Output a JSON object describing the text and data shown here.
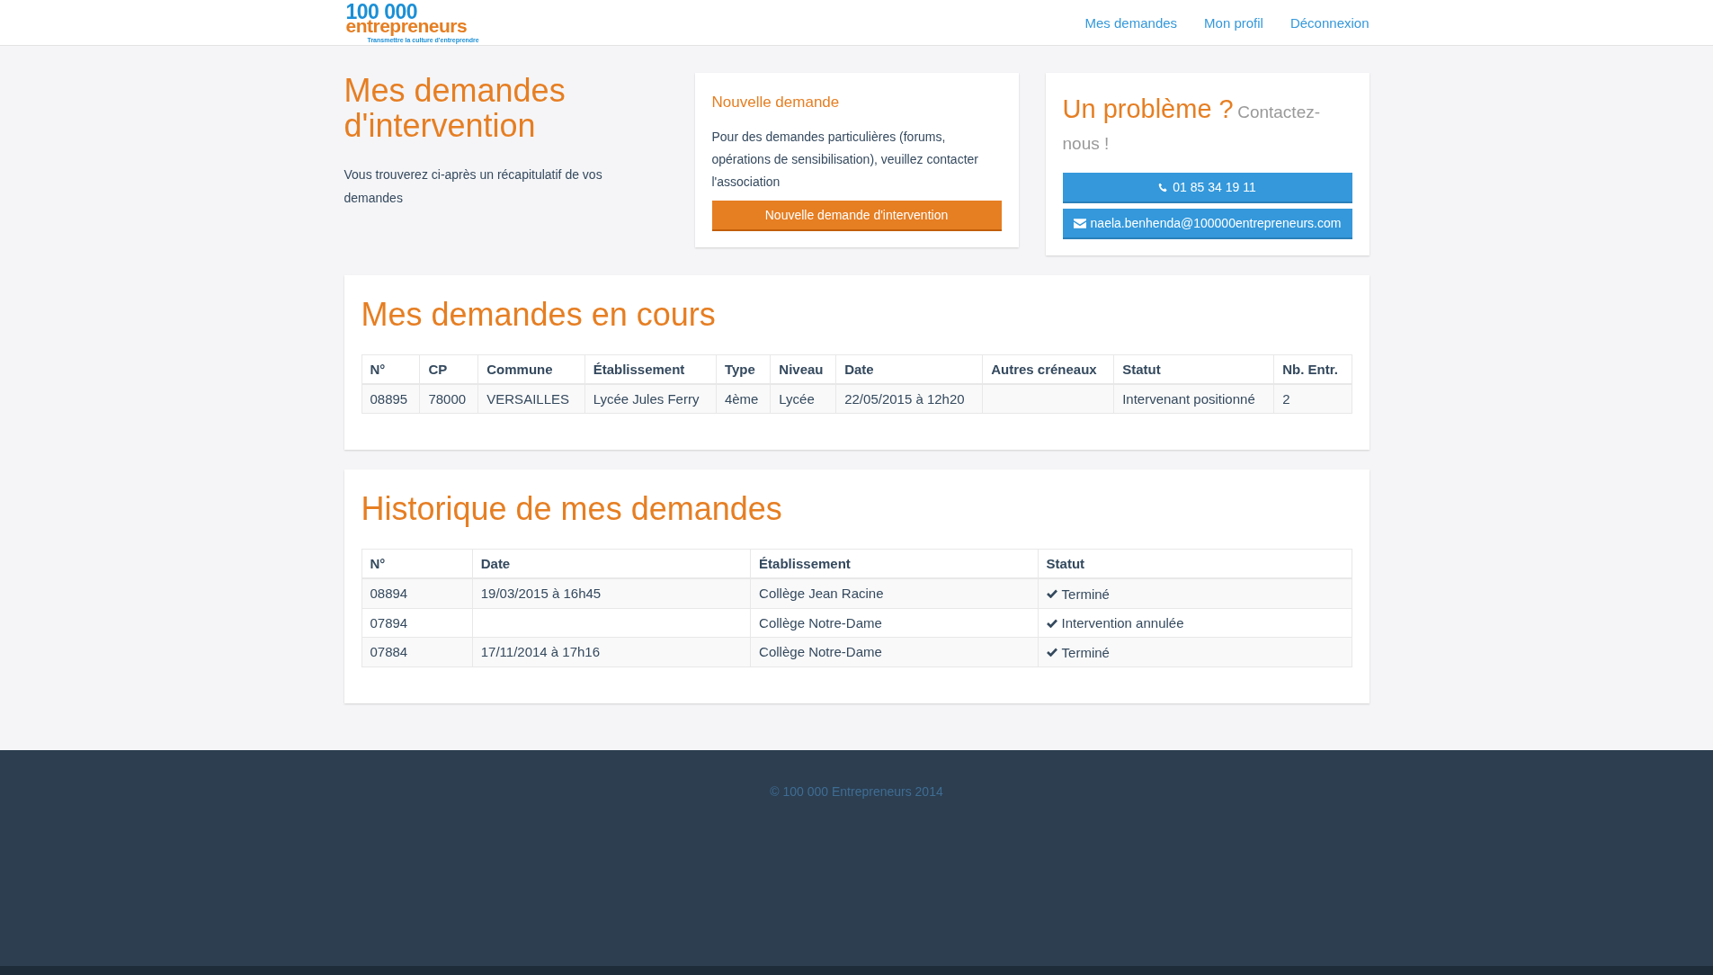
{
  "header": {
    "logo": {
      "number": "100 000",
      "word": "entrepreneurs",
      "tagline": "Transmettre la culture d'entreprendre"
    },
    "nav": [
      {
        "label": "Mes demandes"
      },
      {
        "label": "Mon profil"
      },
      {
        "label": "Déconnexion"
      }
    ]
  },
  "intro": {
    "title": "Mes demandes d'intervention",
    "text": "Vous trouverez ci-après un récapitulatif de vos demandes"
  },
  "new_request": {
    "title": "Nouvelle demande",
    "text": "Pour des demandes particulières (forums, opérations de sensibilisation), veuillez contacter l'association",
    "button": "Nouvelle demande d'intervention"
  },
  "contact": {
    "title": "Un problème ?",
    "subtitle": "Contactez-nous !",
    "buttons": [
      {
        "kind": "phone",
        "label": "01 85 34 19 11"
      },
      {
        "kind": "email",
        "label": "naela.benhenda@100000entrepreneurs.com"
      }
    ]
  },
  "sections": [
    {
      "title": "Mes demandes en cours",
      "columns": [
        {
          "label": "N°",
          "kind": "text"
        },
        {
          "label": "CP",
          "kind": "text"
        },
        {
          "label": "Commune",
          "kind": "text"
        },
        {
          "label": "Établissement",
          "kind": "text"
        },
        {
          "label": "Type",
          "kind": "text"
        },
        {
          "label": "Niveau",
          "kind": "text"
        },
        {
          "label": "Date",
          "kind": "text"
        },
        {
          "label": "Autres créneaux",
          "kind": "text"
        },
        {
          "label": "Statut",
          "kind": "text"
        },
        {
          "label": "Nb. Entr.",
          "kind": "text"
        }
      ],
      "rows": [
        [
          "08895",
          "78000",
          "VERSAILLES",
          "Lycée Jules Ferry",
          "4ème",
          "Lycée",
          "22/05/2015 à 12h20",
          "",
          "Intervenant positionné",
          "2"
        ]
      ]
    },
    {
      "title": "Historique de mes demandes",
      "columns": [
        {
          "label": "N°",
          "kind": "text"
        },
        {
          "label": "Date",
          "kind": "text"
        },
        {
          "label": "Établissement",
          "kind": "text"
        },
        {
          "label": "Statut",
          "kind": "status"
        }
      ],
      "rows": [
        [
          "08894",
          "19/03/2015 à 16h45",
          "Collège Jean Racine",
          "Terminé"
        ],
        [
          "07894",
          "",
          "Collège Notre-Dame",
          "Intervention annulée"
        ],
        [
          "07884",
          "17/11/2014 à 17h16",
          "Collège Notre-Dame",
          "Terminé"
        ]
      ]
    }
  ],
  "footer": {
    "text": "© 100 000 Entrepreneurs 2014"
  }
}
